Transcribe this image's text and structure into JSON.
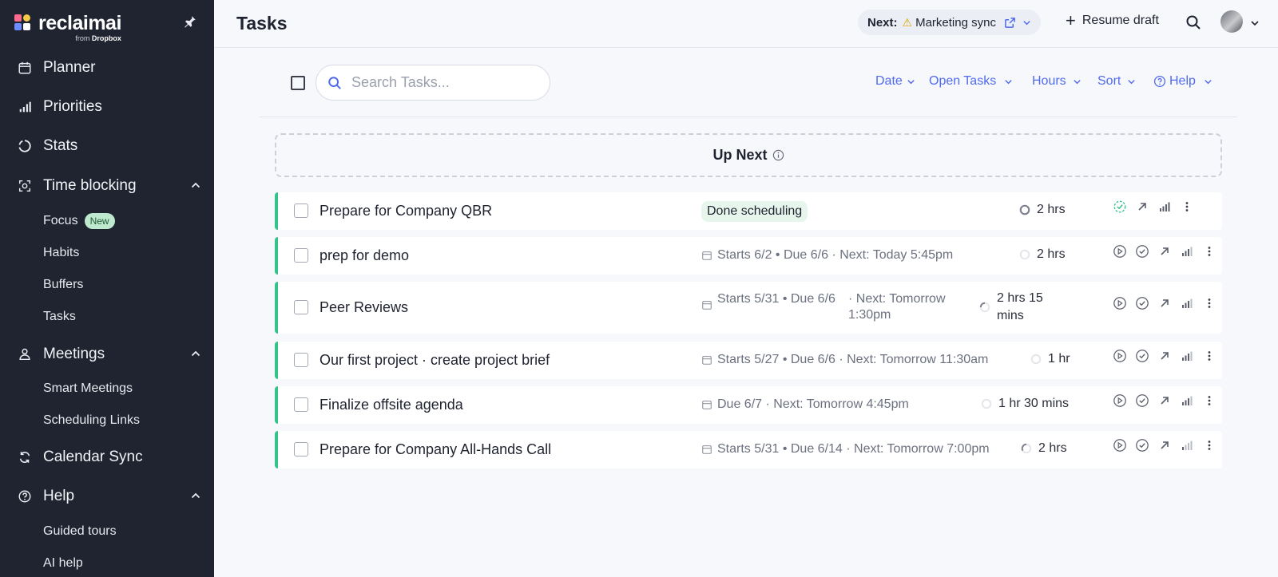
{
  "app": {
    "logo_name": "reclaimai",
    "logo_sub_prefix": "from",
    "logo_sub_brand": "Dropbox"
  },
  "sidebar": {
    "items": [
      {
        "label": "Planner",
        "icon": "calendar-icon"
      },
      {
        "label": "Priorities",
        "icon": "bars-icon"
      },
      {
        "label": "Stats",
        "icon": "stats-icon"
      },
      {
        "label": "Time blocking",
        "icon": "focus-icon"
      },
      {
        "label": "Meetings",
        "icon": "people-icon"
      },
      {
        "label": "Calendar Sync",
        "icon": "sync-icon"
      },
      {
        "label": "Help",
        "icon": "help-icon"
      }
    ],
    "time_blocking_sub": [
      "Focus",
      "Habits",
      "Buffers",
      "Tasks"
    ],
    "focus_badge": "New",
    "meetings_sub": [
      "Smart Meetings",
      "Scheduling Links"
    ],
    "help_sub": [
      "Guided tours",
      "AI help"
    ]
  },
  "header": {
    "title": "Tasks",
    "next_label": "Next:",
    "next_event": "Marketing sync",
    "resume_label": "Resume draft"
  },
  "toolbar": {
    "search_placeholder": "Search Tasks...",
    "filters": [
      "Date",
      "Open Tasks",
      "Hours",
      "Sort",
      "Help"
    ]
  },
  "up_next": {
    "label": "Up Next"
  },
  "tasks": [
    {
      "title": "Prepare for Company QBR",
      "status": "Done scheduling",
      "duration": "2 hrs"
    },
    {
      "title": "prep for demo",
      "schedule": "Starts 6/2 • Due 6/6 · Next: Today 5:45pm",
      "duration": "2 hrs"
    },
    {
      "title": "Peer Reviews",
      "schedule_a": "Starts 5/31 • Due 6/6",
      "schedule_b": "· Next: Tomorrow 1:30pm",
      "duration": "2 hrs 15 mins"
    },
    {
      "title": "Our first project · create project brief",
      "schedule": "Starts 5/27 • Due 6/6 · Next: Tomorrow 11:30am",
      "duration": "1 hr"
    },
    {
      "title": "Finalize offsite agenda",
      "schedule": "Due 6/7 · Next: Tomorrow 4:45pm",
      "duration": "1 hr 30 mins"
    },
    {
      "title": "Prepare for Company All-Hands Call",
      "schedule": "Starts 5/31 • Due 6/14 · Next: Tomorrow 7:00pm",
      "duration": "2 hrs"
    }
  ],
  "colors": {
    "sidebar_bg": "#1f2430",
    "accent": "#4f6bed",
    "task_border": "#34c38a",
    "badge_new_bg": "#bfe9cf"
  }
}
